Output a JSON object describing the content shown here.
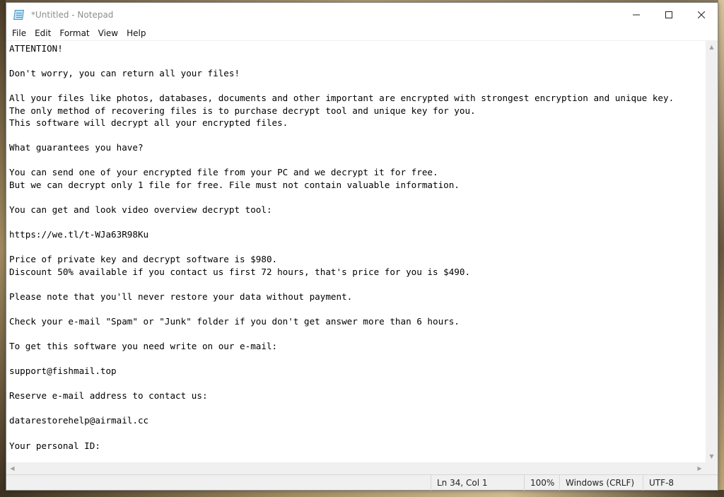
{
  "window": {
    "title": "*Untitled - Notepad"
  },
  "menu": {
    "items": [
      "File",
      "Edit",
      "Format",
      "View",
      "Help"
    ]
  },
  "editor": {
    "lines": [
      "ATTENTION!",
      "",
      "Don't worry, you can return all your files!",
      "",
      "All your files like photos, databases, documents and other important are encrypted with strongest encryption and unique key.",
      "The only method of recovering files is to purchase decrypt tool and unique key for you.",
      "This software will decrypt all your encrypted files.",
      "",
      "What guarantees you have?",
      "",
      "You can send one of your encrypted file from your PC and we decrypt it for free.",
      "But we can decrypt only 1 file for free. File must not contain valuable information.",
      "",
      "You can get and look video overview decrypt tool:",
      "",
      "https://we.tl/t-WJa63R98Ku",
      "",
      "Price of private key and decrypt software is $980.",
      "Discount 50% available if you contact us first 72 hours, that's price for you is $490.",
      "",
      "Please note that you'll never restore your data without payment.",
      "",
      "Check your e-mail \"Spam\" or \"Junk\" folder if you don't get answer more than 6 hours.",
      "",
      "To get this software you need write on our e-mail:",
      "",
      "support@fishmail.top",
      "",
      "Reserve e-mail address to contact us:",
      "",
      "datarestorehelp@airmail.cc",
      "",
      "Your personal ID:"
    ]
  },
  "status": {
    "position": "Ln 34, Col 1",
    "zoom": "100%",
    "line_ending": "Windows (CRLF)",
    "encoding": "UTF-8"
  },
  "icons": {
    "app": "notepad-icon",
    "minimize": "minimize-icon",
    "maximize": "maximize-icon",
    "close": "close-icon",
    "scroll_up": "chevron-up-icon",
    "scroll_down": "chevron-down-icon",
    "scroll_left": "chevron-left-icon",
    "scroll_right": "chevron-right-icon"
  }
}
